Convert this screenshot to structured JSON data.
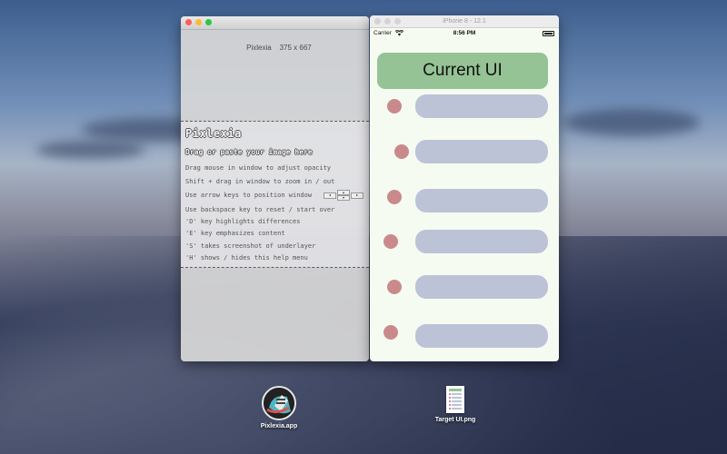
{
  "pixlexia_window": {
    "title": "Pixlexia    375 x 667",
    "help": {
      "title": "Pixlexia",
      "subtitle": "Drag or paste your image here",
      "lines": [
        "Drag mouse in window to adjust opacity",
        "Shift + drag in window to zoom in / out",
        "Use arrow keys to position window",
        "Use backspace key to reset / start over",
        "'D' key highlights differences",
        "'E' key emphasizes content",
        "'S' takes screenshot of underlayer",
        "'H' shows / hides this help menu"
      ],
      "arrow_keys": {
        "left": "◂",
        "up": "▴",
        "down": "▾",
        "right": "▸"
      }
    }
  },
  "simulator_window": {
    "title": "iPhone 8 - 12.1",
    "status_bar": {
      "carrier": "Carrier",
      "time": "8:56 PM"
    },
    "header_label": "Current UI",
    "row_count": 6
  },
  "desktop": {
    "icons": [
      {
        "label": "Pixlexia.app"
      },
      {
        "label": "Target UI.png"
      }
    ]
  },
  "colors": {
    "header_bg": "#95c395",
    "dot": "#ca8a8c",
    "bar": "#bcc3d7",
    "sim_bg": "#f6fbf1"
  }
}
